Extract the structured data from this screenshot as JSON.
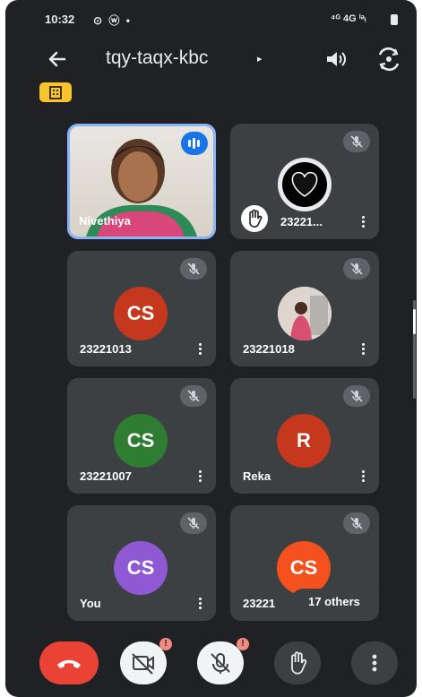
{
  "status_bar": {
    "time": "10:32",
    "left_icons": "⊙ ⓦ •",
    "right_text": "⁴ᴳ 4G ⁱᵃᵢ"
  },
  "header": {
    "meeting_code": "tqy-taqx-kbc",
    "chevron": "▸"
  },
  "participants": [
    {
      "name": "Nivethiya",
      "type": "video",
      "speaking": true
    },
    {
      "name": "23221...",
      "type": "image",
      "hand_raised": true
    },
    {
      "name": "23221013",
      "initials": "CS",
      "color": "#c5381e"
    },
    {
      "name": "23221018",
      "type": "image"
    },
    {
      "name": "23221007",
      "initials": "CS",
      "color": "#2e7d32"
    },
    {
      "name": "Reka",
      "initials": "R",
      "color": "#c5381e"
    },
    {
      "name": "You",
      "initials": "CS",
      "color": "#8e59d2"
    },
    {
      "name": "23221",
      "initials": "CS",
      "color": "#f4511e"
    }
  ],
  "others_chip": "17 others",
  "controls": {
    "badge_camera": "!",
    "badge_mic": "!"
  },
  "colors": {
    "end_call": "#ea4335",
    "speaking": "#1a73e8",
    "active_border": "#8ab4f8"
  }
}
